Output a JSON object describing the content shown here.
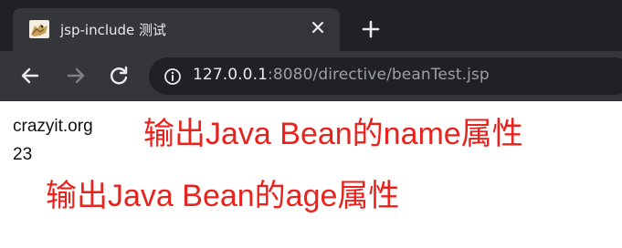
{
  "tab": {
    "title": "jsp-include 测试"
  },
  "address_bar": {
    "host": "127.0.0.1",
    "rest": ":8080/directive/beanTest.jsp"
  },
  "page": {
    "lines": [
      "crazyit.org",
      "23"
    ],
    "annotations": {
      "name": "输出Java Bean的name属性",
      "age": "输出Java Bean的age属性"
    }
  },
  "colors": {
    "annotation": "#e8231e",
    "chrome_bg": "#202124",
    "toolbar_bg": "#35363a"
  }
}
